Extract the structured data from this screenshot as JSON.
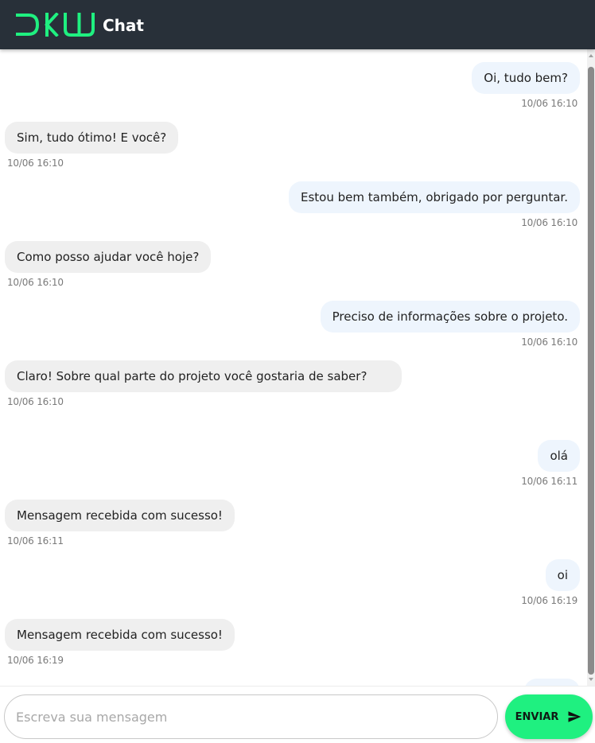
{
  "header": {
    "logo_text": "DKW",
    "title": "Chat",
    "accent_color": "#1ff080",
    "background_color": "#283039"
  },
  "messages": [
    {
      "side": "sent",
      "text": "Oi, tudo bem?",
      "time": "10/06 16:10"
    },
    {
      "side": "received",
      "text": "Sim, tudo ótimo! E você?",
      "time": "10/06 16:10"
    },
    {
      "side": "sent",
      "text": "Estou bem também, obrigado por perguntar.",
      "time": "10/06 16:10"
    },
    {
      "side": "received",
      "text": "Como posso ajudar você hoje?",
      "time": "10/06 16:10"
    },
    {
      "side": "sent",
      "text": "Preciso de informações sobre o projeto.",
      "time": "10/06 16:10"
    },
    {
      "side": "received",
      "text": "Claro! Sobre qual parte do projeto você gostaria de saber?",
      "time": "10/06 16:10"
    },
    {
      "side": "sent",
      "text": "olá",
      "time": "10/06 16:11"
    },
    {
      "side": "received",
      "text": "Mensagem recebida com sucesso!",
      "time": "10/06 16:11"
    },
    {
      "side": "sent",
      "text": "oi",
      "time": "10/06 16:19"
    },
    {
      "side": "received",
      "text": "Mensagem recebida com sucesso!",
      "time": "10/06 16:19"
    }
  ],
  "composer": {
    "placeholder": "Escreva sua mensagem",
    "value": "",
    "send_label": "ENVIAR",
    "send_icon": "send-icon"
  }
}
